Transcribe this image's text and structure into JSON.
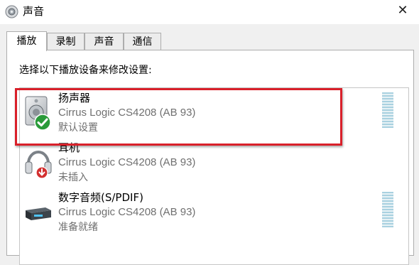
{
  "window": {
    "title": "声音",
    "icon": "speaker-icon",
    "close_glyph": "✕"
  },
  "tabs": [
    {
      "label": "播放",
      "active": true
    },
    {
      "label": "录制",
      "active": false
    },
    {
      "label": "声音",
      "active": false
    },
    {
      "label": "通信",
      "active": false
    }
  ],
  "instruction": "选择以下播放设备来修改设置:",
  "devices": [
    {
      "name": "扬声器",
      "driver": "Cirrus Logic CS4208 (AB 93)",
      "status": "默认设置",
      "icon": "speaker-icon",
      "badge": "default-check-icon",
      "highlighted": true
    },
    {
      "name": "耳机",
      "driver": "Cirrus Logic CS4208 (AB 93)",
      "status": "未插入",
      "icon": "headphones-icon",
      "badge": "unplugged-arrow-icon",
      "highlighted": false
    },
    {
      "name": "数字音频(S/PDIF)",
      "driver": "Cirrus Logic CS4208 (AB 93)",
      "status": "准备就绪",
      "icon": "spdif-device-icon",
      "highlighted": false
    }
  ],
  "colors": {
    "highlight_border": "#d9202a",
    "check_green": "#2a9b3a",
    "unplugged_red": "#d32f2f",
    "level_meter": "#a9d1e0"
  }
}
